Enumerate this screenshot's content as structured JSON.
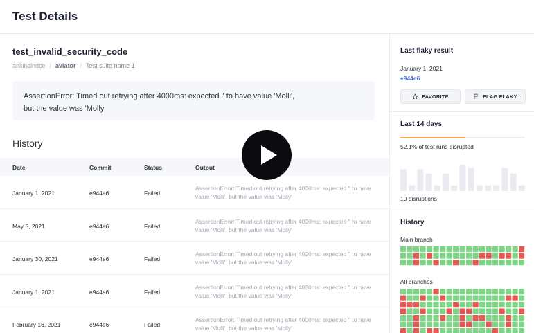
{
  "header": {
    "title": "Test Details"
  },
  "test": {
    "name": "test_invalid_security_code",
    "owner": "ankitjaindce",
    "repo": "aviator",
    "suite": "Test suite name 1",
    "error_line1": "AssertionError: Timed out retrying after 4000ms: expected '' to have value 'Molli',",
    "error_line2": "but the value was 'Molly'"
  },
  "history": {
    "title": "History",
    "columns": {
      "date": "Date",
      "commit": "Commit",
      "status": "Status",
      "output": "Output"
    },
    "rows": [
      {
        "date": "January 1, 2021",
        "commit": "e944e6",
        "status": "Failed",
        "output": "AssertionError: Timed out retrying after 4000ms: expected '' to have value 'Molli', but the value was 'Molly'"
      },
      {
        "date": "May 5, 2021",
        "commit": "e944e6",
        "status": "Failed",
        "output": "AssertionError: Timed out retrying after 4000ms: expected '' to have value 'Molli', but the value was 'Molly'"
      },
      {
        "date": "January 30, 2021",
        "commit": "e944e6",
        "status": "Failed",
        "output": "AssertionError: Timed out retrying after 4000ms: expected '' to have value 'Molli', but the value was 'Molly'"
      },
      {
        "date": "January 1, 2021",
        "commit": "e944e6",
        "status": "Failed",
        "output": "AssertionError: Timed out retrying after 4000ms: expected '' to have value 'Molli', but the value was 'Molly'"
      },
      {
        "date": "February 16, 2021",
        "commit": "e944e6",
        "status": "Failed",
        "output": "AssertionError: Timed out retrying after 4000ms: expected '' to have value 'Molli', but the value was 'Molly'"
      }
    ]
  },
  "sidebar": {
    "last_flaky": {
      "title": "Last flaky result",
      "date": "January 1, 2021",
      "commit": "e944e6",
      "favorite_label": "FAVORITE",
      "flag_label": "FLAG FLAKY"
    },
    "last_14_days": {
      "title": "Last 14 days",
      "disrupted_text": "52.1% of test runs disrupted",
      "disrupted_fraction": 0.521,
      "bar_levels": [
        0.75,
        0.2,
        0.75,
        0.6,
        0.2,
        0.6,
        0.2,
        0.9,
        0.8,
        0.2,
        0.2,
        0.2,
        0.8,
        0.6,
        0.2
      ],
      "disruptions_text": "10 disruptions"
    },
    "history": {
      "title": "History",
      "main_label": "Main branch",
      "main_cells": "GGGGGGGGGGGGGGGGGGRGGRGRGGGGGGGRRGRRGRGGRGGRGGRGGRGGGGGGG",
      "all_label": "All branches",
      "all_cells": "GGGGGRGGGGGGGGGGGGGRGGRGGRGGGGGGGGGRRGRRRGGGGGRGGRGGGGGGGRGGRGGGRGRRGGGGRGGRGGRGGGRGGRGRRGGGRGGGGRGGGGGGRRGGRGGRGGRGRGRRGGGGGGGGRGGGGG"
    },
    "colors": {
      "pass": "#7fd487",
      "fail": "#e25a54",
      "bar": "#e9ebf0",
      "accent": "#f2a955",
      "link": "#4a6fd8"
    }
  },
  "video": {
    "icon": "play-icon"
  }
}
